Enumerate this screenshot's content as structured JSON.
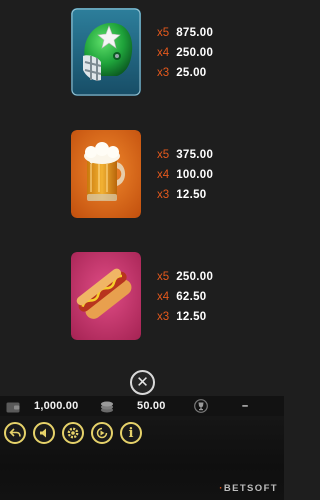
{
  "paytable": {
    "symbols": [
      {
        "name": "football-helmet",
        "icon": "football-helmet-icon",
        "pays": [
          {
            "mult": "x5",
            "amount": "875.00"
          },
          {
            "mult": "x4",
            "amount": "250.00"
          },
          {
            "mult": "x3",
            "amount": "25.00"
          }
        ]
      },
      {
        "name": "beer-mug",
        "icon": "beer-mug-icon",
        "pays": [
          {
            "mult": "x5",
            "amount": "375.00"
          },
          {
            "mult": "x4",
            "amount": "100.00"
          },
          {
            "mult": "x3",
            "amount": "12.50"
          }
        ]
      },
      {
        "name": "hot-dog",
        "icon": "hot-dog-icon",
        "pays": [
          {
            "mult": "x5",
            "amount": "250.00"
          },
          {
            "mult": "x4",
            "amount": "62.50"
          },
          {
            "mult": "x3",
            "amount": "12.50"
          }
        ]
      }
    ]
  },
  "status": {
    "balance": "1,000.00",
    "bet": "50.00",
    "win": "–",
    "icons": [
      "wallet-icon",
      "coins-icon",
      "trophy-icon"
    ]
  },
  "controls": {
    "icons": [
      "back-icon",
      "sound-icon",
      "settings-icon",
      "autoplay-icon",
      "info-icon"
    ],
    "info_glyph": "i"
  },
  "brand": {
    "prefix": "·",
    "name": "BETSOFT"
  },
  "colors": {
    "background": "#1e1e1e",
    "multiplier": "#e6591c",
    "amount": "#ffffff",
    "control_ring": "#e6d26a",
    "helmet_tile": "#1f6a8c",
    "beer_tile": "#d9641a",
    "hotdog_tile": "#c2336b"
  }
}
